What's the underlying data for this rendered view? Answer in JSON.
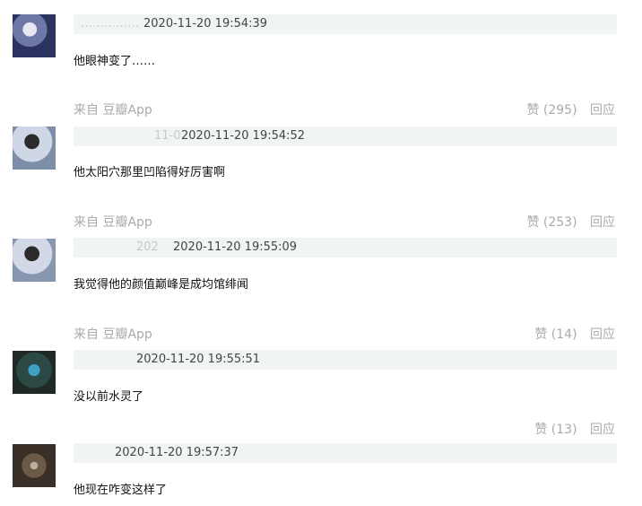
{
  "comments": [
    {
      "source": "",
      "like": "",
      "reply": "",
      "timestamp": "2020-11-20 19:54:39",
      "prefix": "……………",
      "text": "他眼神变了……",
      "avatar_icon": "user-avatar-icon"
    },
    {
      "source": "来自 豆瓣App",
      "like": "赞 (295)",
      "reply": "回应",
      "timestamp": "2020-11-20 19:54:52",
      "prefix": "11-0",
      "text": "他太阳穴那里凹陷得好厉害啊",
      "avatar_icon": "user-avatar-icon"
    },
    {
      "source": "来自 豆瓣App",
      "like": "赞 (253)",
      "reply": "回应",
      "timestamp": "2020-11-20 19:55:09",
      "prefix": "202",
      "text": "我觉得他的颜值巅峰是成均馆绯闻",
      "avatar_icon": "user-avatar-icon"
    },
    {
      "source": "来自 豆瓣App",
      "like": "赞 (14)",
      "reply": "回应",
      "timestamp": "2020-11-20 19:55:51",
      "prefix": "",
      "text": "没以前水灵了",
      "avatar_icon": "user-avatar-icon"
    },
    {
      "source": "",
      "like": "赞 (13)",
      "reply": "回应",
      "timestamp": "2020-11-20 19:57:37",
      "prefix": "",
      "text": "他现在咋变这样了",
      "avatar_icon": "user-avatar-icon"
    }
  ]
}
